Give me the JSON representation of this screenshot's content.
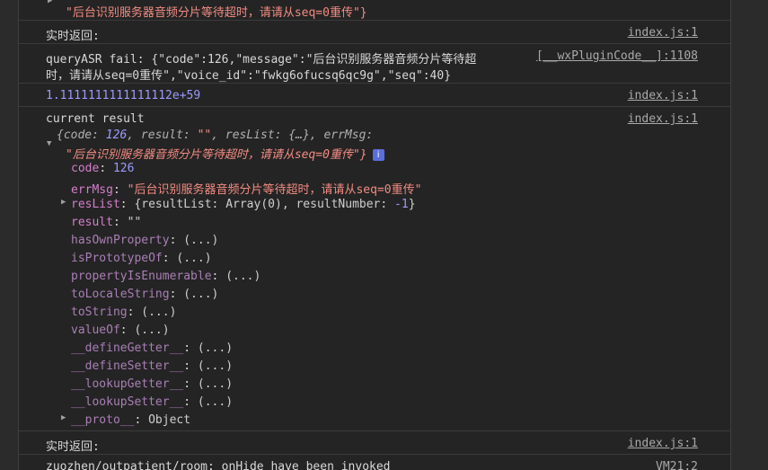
{
  "top_partial": "\"后台识别服务器音频分片等待超时，请请从seq=0重传\"}",
  "messages": [
    {
      "text": "实时返回:",
      "source": "index.js:1"
    },
    {
      "text_line1": "queryASR fail: {\"code\":126,\"message\":\"后台识别服务器音频分片等待超",
      "text_line2": "时，请请从seq=0重传\",\"voice_id\":\"fwkg6ofucsq6qc9g\",\"seq\":40}",
      "source": "[__wxPluginCode__]:1108"
    },
    {
      "text": "1.1111111111111112e+59",
      "source": "index.js:1"
    },
    {
      "text": "current result",
      "source": "index.js:1"
    }
  ],
  "object_summary": {
    "line1_prefix": "{code: ",
    "code": "126",
    "line1_mid": ", result: ",
    "result": "\"\"",
    "line1_rest": ", resList: {…}, errMsg:",
    "line2": "\"后台识别服务器音频分片等待超时，请请从seq=0重传\"}",
    "info_icon": "i"
  },
  "properties": [
    {
      "key": "code",
      "value": "126",
      "type": "num"
    },
    {
      "key": "errMsg",
      "value": "\"后台识别服务器音频分片等待超时，请请从seq=0重传\"",
      "type": "str"
    },
    {
      "key": "resList",
      "value_prefix": "{resultList: Array(0), resultNumber: ",
      "value_num": "-1",
      "value_suffix": "}",
      "type": "obj"
    },
    {
      "key": "result",
      "value": "\"\"",
      "type": "plain"
    },
    {
      "key": "hasOwnProperty",
      "value": "(...)"
    },
    {
      "key": "isPrototypeOf",
      "value": "(...)"
    },
    {
      "key": "propertyIsEnumerable",
      "value": "(...)"
    },
    {
      "key": "toLocaleString",
      "value": "(...)"
    },
    {
      "key": "toString",
      "value": "(...)"
    },
    {
      "key": "valueOf",
      "value": "(...)"
    },
    {
      "key": "__defineGetter__",
      "value": "(...)"
    },
    {
      "key": "__defineSetter__",
      "value": "(...)"
    },
    {
      "key": "__lookupGetter__",
      "value": "(...)"
    },
    {
      "key": "__lookupSetter__",
      "value": "(...)"
    },
    {
      "key": "__proto__",
      "value": "Object"
    }
  ],
  "bottom_messages": [
    {
      "text": "实时返回:",
      "source": "index.js:1"
    },
    {
      "text": "zuozhen/outpatient/room: onHide have been invoked",
      "source": "VM21:2"
    }
  ],
  "colors": {
    "string": "#f28b82",
    "number": "#9b9bff",
    "key": "#d57dcc",
    "background": "#242424"
  }
}
